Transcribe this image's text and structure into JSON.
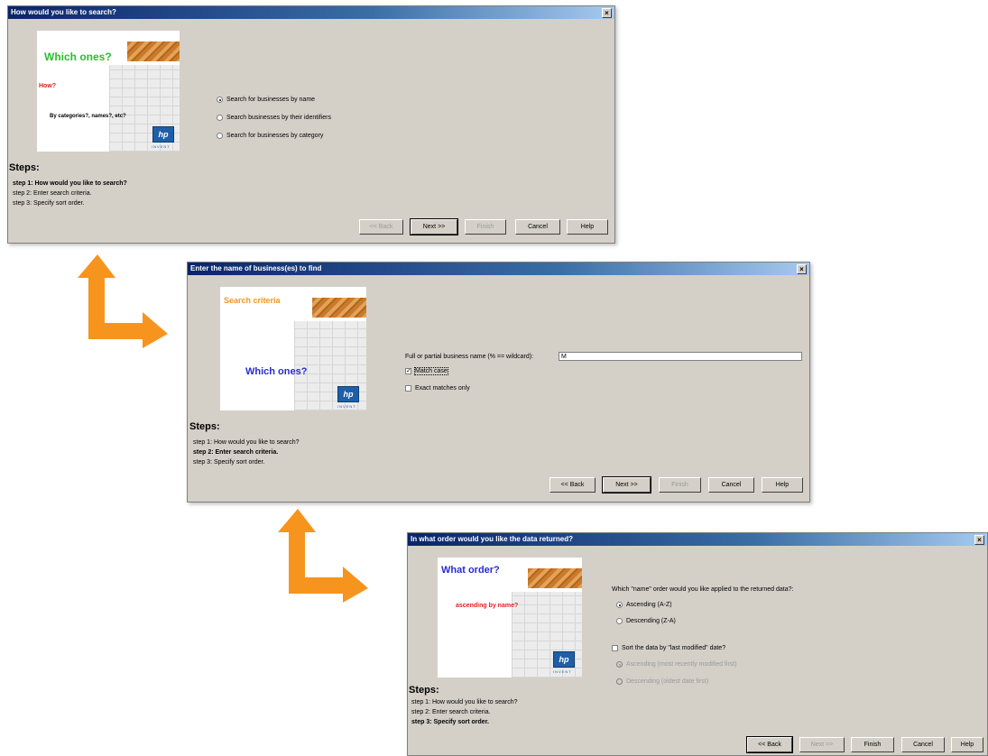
{
  "dialogs": [
    {
      "title": "How would you like to search?",
      "art": {
        "line1": "Which ones?",
        "line2": "How?",
        "line3": "By categories?, names?, etc?",
        "logo": "hp",
        "logo_sub": "INVENT"
      },
      "options": [
        {
          "label": "Search for businesses by name",
          "selected": true
        },
        {
          "label": "Search businesses by their identifiers",
          "selected": false
        },
        {
          "label": "Search for businesses by category",
          "selected": false
        }
      ],
      "steps_title": "Steps:",
      "steps": [
        "step 1: How would you like to search?",
        "step 2: Enter search criteria.",
        "step 3: Specify sort order."
      ],
      "current_step": 0,
      "buttons": {
        "back": "<< Back",
        "next": "Next >>",
        "finish": "Finish",
        "cancel": "Cancel",
        "help": "Help"
      }
    },
    {
      "title": "Enter the name of business(es) to find",
      "art": {
        "line1": "Search criteria",
        "line2": "Which ones?",
        "logo": "hp",
        "logo_sub": "INVENT"
      },
      "name_label": "Full or partial business name (% == wildcard):",
      "name_value": "M",
      "match_case": {
        "label": "Match case",
        "checked": true
      },
      "exact_only": {
        "label": "Exact matches only",
        "checked": false
      },
      "steps_title": "Steps:",
      "steps": [
        "step 1: How would you like to search?",
        "step 2: Enter search criteria.",
        "step 3: Specify sort order."
      ],
      "current_step": 1,
      "buttons": {
        "back": "<< Back",
        "next": "Next >>",
        "finish": "Finish",
        "cancel": "Cancel",
        "help": "Help"
      }
    },
    {
      "title": "In what order would you like the data returned?",
      "art": {
        "line1": "What order?",
        "line2": "ascending by name?",
        "logo": "hp",
        "logo_sub": "INVENT"
      },
      "order_question": "Which \"name\" order would you like applied to the returned data?:",
      "order_options": [
        {
          "label": "Ascending (A-Z)",
          "selected": true
        },
        {
          "label": "Descending (Z-A)",
          "selected": false
        }
      ],
      "sort_modified": {
        "label": "Sort the data by \"last modified\" date?",
        "checked": false
      },
      "date_options": [
        {
          "label": "Ascending (most recently modified first)",
          "selected": true
        },
        {
          "label": "Descending (oldest date first)",
          "selected": false
        }
      ],
      "steps_title": "Steps:",
      "steps": [
        "step 1: How would you like to search?",
        "step 2: Enter search criteria.",
        "step 3: Specify sort order."
      ],
      "current_step": 2,
      "buttons": {
        "back": "<< Back",
        "next": "Next >>",
        "finish": "Finish",
        "cancel": "Cancel",
        "help": "Help"
      }
    }
  ],
  "colors": {
    "arrow": "#f7941d",
    "title_bar": "#0a246a",
    "dialog_bg": "#d4d0c8"
  }
}
